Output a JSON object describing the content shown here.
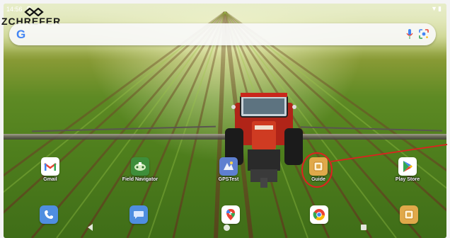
{
  "status_bar": {
    "time": "14:56",
    "settings_icon": "gear-icon",
    "right_icons": [
      "wifi-icon",
      "battery-icon"
    ]
  },
  "brand": {
    "name": "ZCHREFER"
  },
  "search": {
    "logo": "G",
    "icons": [
      "mic-icon",
      "lens-icon"
    ]
  },
  "apps": [
    {
      "id": "gmail",
      "label": "Gmail",
      "icon": "gmail-icon",
      "color": "#ffffff"
    },
    {
      "id": "field-navigator",
      "label": "Field Navigator",
      "icon": "field-navigator-icon",
      "color": "#3e8e3a"
    },
    {
      "id": "gpstest",
      "label": "GPSTest",
      "icon": "gpstest-icon",
      "color": "#5e7fd0"
    },
    {
      "id": "guide",
      "label": "Guide",
      "icon": "guide-icon",
      "color": "#e0a94a"
    },
    {
      "id": "play-store",
      "label": "Play Store",
      "icon": "play-store-icon",
      "color": "#ffffff"
    }
  ],
  "dock": [
    {
      "id": "phone",
      "icon": "phone-icon",
      "color": "#4f8ee0"
    },
    {
      "id": "messages",
      "icon": "messages-icon",
      "color": "#4f8ee0"
    },
    {
      "id": "maps",
      "icon": "maps-icon",
      "color": "#ffffff"
    },
    {
      "id": "chrome",
      "icon": "chrome-icon",
      "color": "#ffffff"
    },
    {
      "id": "guide",
      "icon": "guide-icon",
      "color": "#e0a94a"
    }
  ],
  "nav": [
    "back-icon",
    "home-icon",
    "recents-icon"
  ],
  "colors": {
    "annotation": "#e02020",
    "google_blue": "#4285f4",
    "google_red": "#ea4335",
    "google_yellow": "#fbbc05",
    "google_green": "#34a853"
  }
}
